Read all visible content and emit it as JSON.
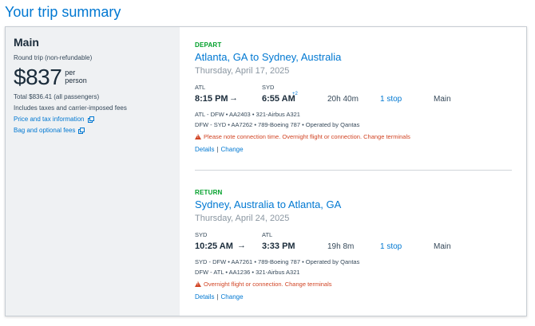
{
  "page": {
    "title": "Your trip summary"
  },
  "fare": {
    "name": "Main",
    "type": "Round trip (non-refundable)",
    "price": "$837",
    "per_person": "per person",
    "total": "Total $836.41 (all passengers)",
    "includes": "Includes taxes and carrier-imposed fees",
    "links": {
      "price_tax": "Price and tax information",
      "bag": "Bag and optional fees"
    }
  },
  "depart": {
    "label": "DEPART",
    "route": "Atlanta, GA to Sydney, Australia",
    "date": "Thursday, April 17, 2025",
    "origin_code": "ATL",
    "dest_code": "SYD",
    "depart_time": "8:15 PM",
    "arrow": "→",
    "arrive_time": "6:55 AM",
    "day_offset": "+2",
    "duration": "20h 40m",
    "stops": "1 stop",
    "cabin": "Main",
    "flights": [
      "ATL - DFW • AA2403 • 321-Airbus A321",
      "DFW - SYD • AA7262 • 789-Boeing 787 • Operated by Qantas"
    ],
    "warning": "Please note connection time. Overnight flight or connection. Change terminals",
    "details": "Details",
    "separator": "|",
    "change": "Change"
  },
  "return": {
    "label": "RETURN",
    "route": "Sydney, Australia to Atlanta, GA",
    "date": "Thursday, April 24, 2025",
    "origin_code": "SYD",
    "dest_code": "ATL",
    "depart_time": "10:25 AM",
    "arrow": "→",
    "arrive_time": "3:33 PM",
    "duration": "19h 8m",
    "stops": "1 stop",
    "cabin": "Main",
    "flights": [
      "SYD - DFW • AA7261 • 789-Boeing 787 • Operated by Qantas",
      "DFW - ATL • AA1236 • 321-Airbus A321"
    ],
    "warning": "Overnight flight or connection. Change terminals",
    "details": "Details",
    "separator": "|",
    "change": "Change"
  },
  "colors": {
    "accent": "#0078d2",
    "label_green": "#00a029",
    "warning": "#d14424"
  }
}
